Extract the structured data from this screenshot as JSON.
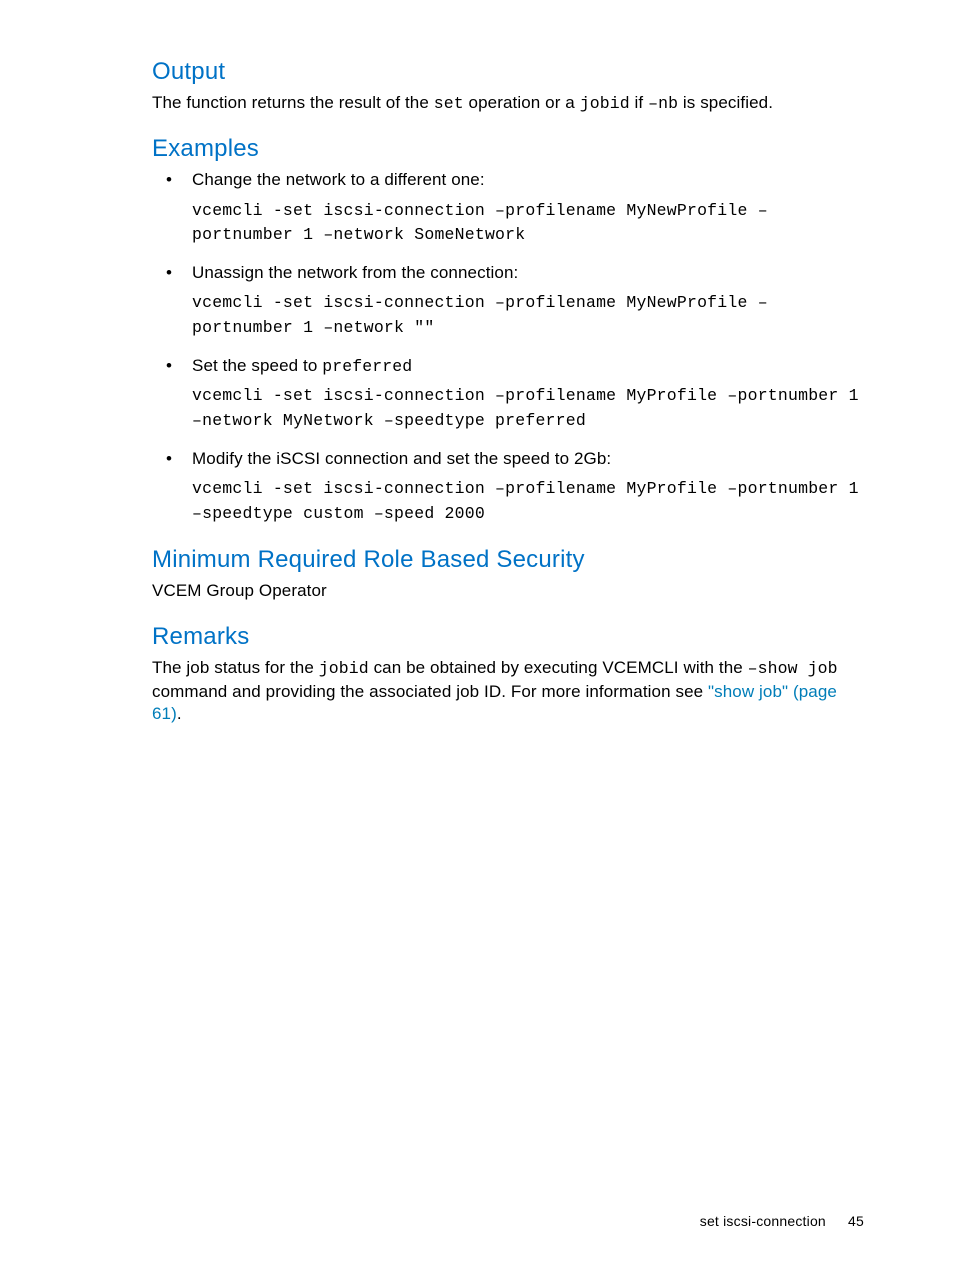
{
  "sections": {
    "output": {
      "heading": "Output",
      "para_pre": "The function returns the result of the ",
      "code1": "set",
      "para_mid": " operation or a ",
      "code2": "jobid",
      "para_mid2": " if ",
      "code3": "–nb",
      "para_post": " is specified."
    },
    "examples": {
      "heading": "Examples",
      "items": [
        {
          "intro_pre": "Change the network to a different one:",
          "intro_code": "",
          "intro_post": "",
          "cmd": "vcemcli -set iscsi-connection –profilename MyNewProfile –portnumber 1 –network SomeNetwork"
        },
        {
          "intro_pre": "Unassign the network from the connection:",
          "intro_code": "",
          "intro_post": "",
          "cmd": "vcemcli -set iscsi-connection –profilename MyNewProfile –portnumber 1 –network \"\""
        },
        {
          "intro_pre": "Set the speed to ",
          "intro_code": "preferred",
          "intro_post": "",
          "cmd": "vcemcli -set iscsi-connection –profilename MyProfile –portnumber 1 –network MyNetwork –speedtype preferred"
        },
        {
          "intro_pre": "Modify the iSCSI connection and set the speed to 2Gb:",
          "intro_code": "",
          "intro_post": "",
          "cmd": "vcemcli -set iscsi-connection –profilename MyProfile –portnumber 1 –speedtype custom –speed 2000"
        }
      ]
    },
    "mrrbs": {
      "heading": "Minimum Required Role Based Security",
      "body": "VCEM Group Operator"
    },
    "remarks": {
      "heading": "Remarks",
      "p_pre": "The job status for the ",
      "code1": "jobid",
      "p_mid": " can be obtained by executing VCEMCLI with the ",
      "code2": "–show job",
      "p_mid2": " command and providing the associated job ID. For more information see ",
      "link": "\"show job\" (page 61)",
      "p_post": "."
    }
  },
  "footer": {
    "section": "set iscsi-connection",
    "page": "45"
  }
}
